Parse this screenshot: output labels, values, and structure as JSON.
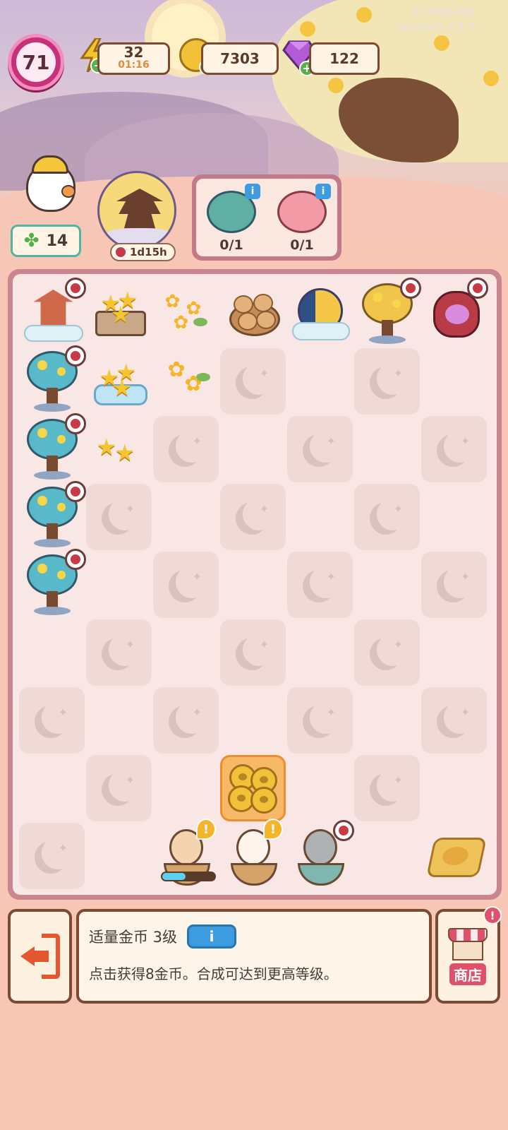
{
  "header": {
    "id_text": "ID:4665708",
    "version_text": "Version1.2.9.2",
    "level": "71",
    "energy": {
      "value": "32",
      "timer": "01:16"
    },
    "coins": "7303",
    "gems": "122"
  },
  "helpers": {
    "duck_count": "14",
    "event_timer": "1d15h"
  },
  "orders": [
    {
      "count": "0/1"
    },
    {
      "count": "0/1"
    }
  ],
  "info": {
    "title": "适量金币 3级",
    "info_button": "i",
    "description": "点击获得8金币。合成可达到更高等级。"
  },
  "shop": {
    "label": "商店"
  },
  "colors": {
    "accent_pink": "#c9307a",
    "board_frame": "#c9868f",
    "info_blue": "#3d9ce0",
    "plus_green": "#56b14a"
  }
}
